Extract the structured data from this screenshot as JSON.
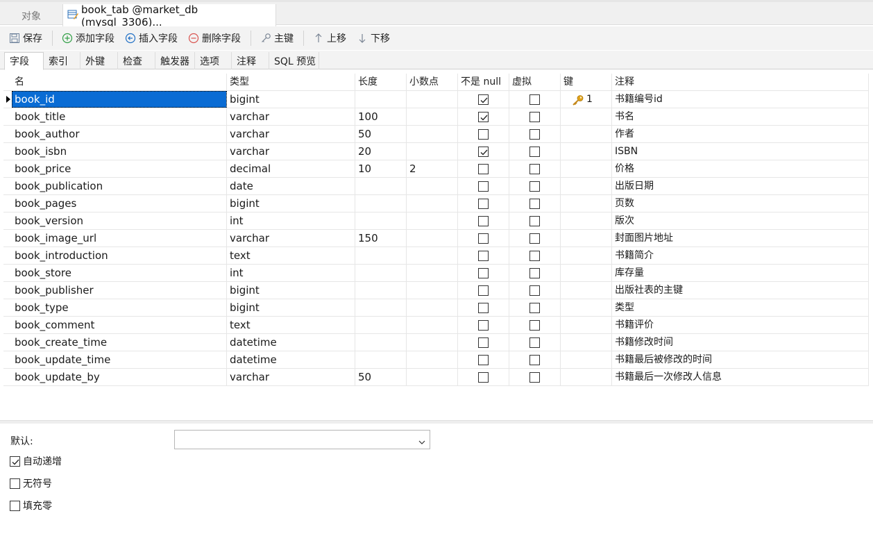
{
  "doc_tabs": {
    "objects": "对象",
    "table": "book_tab @market_db (mysql_3306)..."
  },
  "toolbar": {
    "save": "保存",
    "add_field": "添加字段",
    "insert_field": "插入字段",
    "delete_field": "删除字段",
    "primary_key": "主键",
    "move_up": "上移",
    "move_down": "下移"
  },
  "sub_tabs": [
    "字段",
    "索引",
    "外键",
    "检查",
    "触发器",
    "选项",
    "注释",
    "SQL 预览"
  ],
  "grid": {
    "headers": {
      "name": "名",
      "type": "类型",
      "length": "长度",
      "decimals": "小数点",
      "not_null": "不是 null",
      "virtual": "虚拟",
      "key": "键",
      "comment": "注释"
    },
    "rows": [
      {
        "name": "book_id",
        "type": "bigint",
        "length": "",
        "decimals": "",
        "not_null": true,
        "virtual": false,
        "key": "1",
        "comment": "书籍编号id"
      },
      {
        "name": "book_title",
        "type": "varchar",
        "length": "100",
        "decimals": "",
        "not_null": true,
        "virtual": false,
        "key": "",
        "comment": "书名"
      },
      {
        "name": "book_author",
        "type": "varchar",
        "length": "50",
        "decimals": "",
        "not_null": false,
        "virtual": false,
        "key": "",
        "comment": "作者"
      },
      {
        "name": "book_isbn",
        "type": "varchar",
        "length": "20",
        "decimals": "",
        "not_null": true,
        "virtual": false,
        "key": "",
        "comment": "ISBN"
      },
      {
        "name": "book_price",
        "type": "decimal",
        "length": "10",
        "decimals": "2",
        "not_null": false,
        "virtual": false,
        "key": "",
        "comment": "价格"
      },
      {
        "name": "book_publication",
        "type": "date",
        "length": "",
        "decimals": "",
        "not_null": false,
        "virtual": false,
        "key": "",
        "comment": "出版日期"
      },
      {
        "name": "book_pages",
        "type": "bigint",
        "length": "",
        "decimals": "",
        "not_null": false,
        "virtual": false,
        "key": "",
        "comment": "页数"
      },
      {
        "name": "book_version",
        "type": "int",
        "length": "",
        "decimals": "",
        "not_null": false,
        "virtual": false,
        "key": "",
        "comment": "版次"
      },
      {
        "name": "book_image_url",
        "type": "varchar",
        "length": "150",
        "decimals": "",
        "not_null": false,
        "virtual": false,
        "key": "",
        "comment": "封面图片地址"
      },
      {
        "name": "book_introduction",
        "type": "text",
        "length": "",
        "decimals": "",
        "not_null": false,
        "virtual": false,
        "key": "",
        "comment": "书籍简介"
      },
      {
        "name": "book_store",
        "type": "int",
        "length": "",
        "decimals": "",
        "not_null": false,
        "virtual": false,
        "key": "",
        "comment": "库存量"
      },
      {
        "name": "book_publisher",
        "type": "bigint",
        "length": "",
        "decimals": "",
        "not_null": false,
        "virtual": false,
        "key": "",
        "comment": "出版社表的主键"
      },
      {
        "name": "book_type",
        "type": "bigint",
        "length": "",
        "decimals": "",
        "not_null": false,
        "virtual": false,
        "key": "",
        "comment": "类型"
      },
      {
        "name": "book_comment",
        "type": "text",
        "length": "",
        "decimals": "",
        "not_null": false,
        "virtual": false,
        "key": "",
        "comment": "书籍评价"
      },
      {
        "name": "book_create_time",
        "type": "datetime",
        "length": "",
        "decimals": "",
        "not_null": false,
        "virtual": false,
        "key": "",
        "comment": "书籍修改时间"
      },
      {
        "name": "book_update_time",
        "type": "datetime",
        "length": "",
        "decimals": "",
        "not_null": false,
        "virtual": false,
        "key": "",
        "comment": "书籍最后被修改的时间"
      },
      {
        "name": "book_update_by",
        "type": "varchar",
        "length": "50",
        "decimals": "",
        "not_null": false,
        "virtual": false,
        "key": "",
        "comment": "书籍最后一次修改人信息"
      }
    ]
  },
  "properties": {
    "default_label": "默认:",
    "default_value": "",
    "auto_increment": {
      "label": "自动递增",
      "checked": true
    },
    "unsigned": {
      "label": "无符号",
      "checked": false
    },
    "zerofill": {
      "label": "填充零",
      "checked": false
    }
  },
  "colors": {
    "selection": "#0a6cd4",
    "key_icon": "#e0a21a",
    "add_icon": "#2f9e44",
    "insert_icon": "#1f6fc5",
    "delete_icon": "#d9534f"
  }
}
